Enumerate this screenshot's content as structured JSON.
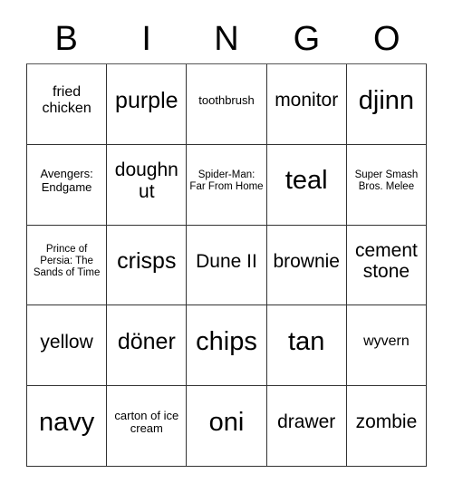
{
  "card": {
    "header_letters": [
      "B",
      "I",
      "N",
      "G",
      "O"
    ],
    "rows": [
      [
        {
          "text": "fried chicken",
          "size": "sm"
        },
        {
          "text": "purple",
          "size": "lg"
        },
        {
          "text": "toothbrush",
          "size": "xs"
        },
        {
          "text": "monitor",
          "size": "md"
        },
        {
          "text": "djinn",
          "size": "xl"
        }
      ],
      [
        {
          "text": "Avengers: Endgame",
          "size": "xs"
        },
        {
          "text": "doughnut",
          "size": "md"
        },
        {
          "text": "Spider-Man: Far From Home",
          "size": "xxs"
        },
        {
          "text": "teal",
          "size": "xl"
        },
        {
          "text": "Super Smash Bros. Melee",
          "size": "xxs"
        }
      ],
      [
        {
          "text": "Prince of Persia: The Sands of Time",
          "size": "xxs"
        },
        {
          "text": "crisps",
          "size": "lg"
        },
        {
          "text": "Dune II",
          "size": "md"
        },
        {
          "text": "brownie",
          "size": "md"
        },
        {
          "text": "cement stone",
          "size": "md"
        }
      ],
      [
        {
          "text": "yellow",
          "size": "md"
        },
        {
          "text": "döner",
          "size": "lg"
        },
        {
          "text": "chips",
          "size": "xl"
        },
        {
          "text": "tan",
          "size": "xl"
        },
        {
          "text": "wyvern",
          "size": "sm"
        }
      ],
      [
        {
          "text": "navy",
          "size": "xl"
        },
        {
          "text": "carton of ice cream",
          "size": "xs"
        },
        {
          "text": "oni",
          "size": "xl"
        },
        {
          "text": "drawer",
          "size": "md"
        },
        {
          "text": "zombie",
          "size": "md"
        }
      ]
    ]
  },
  "colors": {
    "border": "#333333",
    "text": "#000000",
    "background": "#ffffff"
  }
}
